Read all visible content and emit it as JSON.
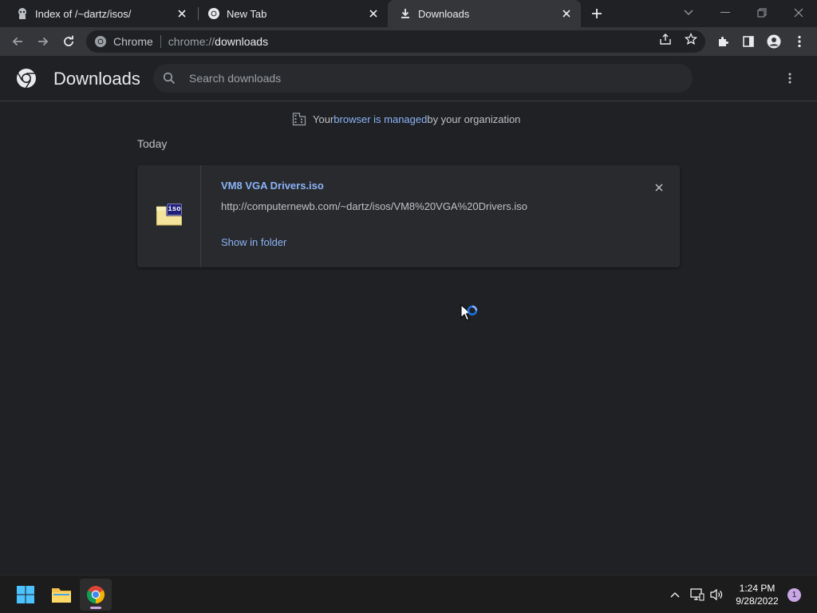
{
  "colors": {
    "background": "#202124",
    "toolbar": "#35363a",
    "link": "#8ab4f8",
    "taskbar": "#1c1c1c",
    "accent": "#c9a7e6"
  },
  "tabs": [
    {
      "title": "Index of /~dartz/isos/",
      "icon": "page-favicon-icon",
      "active": false
    },
    {
      "title": "New Tab",
      "icon": "chrome-icon",
      "active": false
    },
    {
      "title": "Downloads",
      "icon": "download-icon",
      "active": true
    }
  ],
  "omnibox": {
    "chip": "Chrome",
    "url_scheme": "chrome://",
    "url_host": "downloads"
  },
  "downloads": {
    "title": "Downloads",
    "search_placeholder": "Search downloads",
    "managed_prefix": "Your ",
    "managed_link": "browser is managed",
    "managed_suffix": " by your organization",
    "date_header": "Today",
    "items": [
      {
        "file_name": "VM8 VGA Drivers.iso",
        "url": "http://computernewb.com/~dartz/isos/VM8%20VGA%20Drivers.iso",
        "action": "Show in folder",
        "icon_label": "iso"
      }
    ]
  },
  "taskbar": {
    "time": "1:24 PM",
    "date": "9/28/2022",
    "notifications": "1"
  }
}
